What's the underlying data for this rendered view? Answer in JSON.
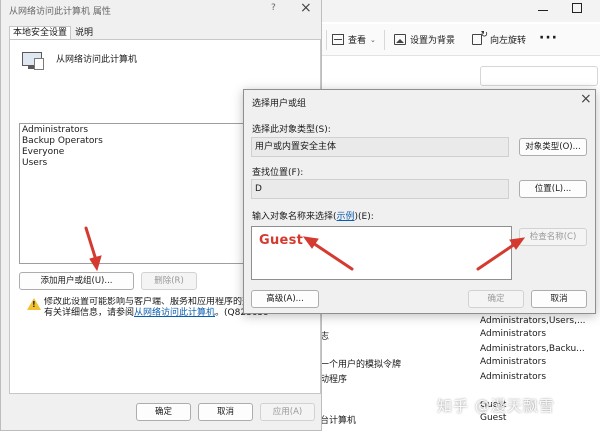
{
  "explorer": {
    "toolbar": {
      "view_label": "查看",
      "set_background_label": "设置为背景",
      "rotate_right_label": "向左旋转",
      "more_label": "···"
    },
    "policy_rows": [
      {
        "policy": "",
        "setting": "Administrators,Users,..."
      },
      {
        "policy": "志",
        "setting": "Administrators"
      },
      {
        "policy": "",
        "setting": "Administrators,Backu..."
      },
      {
        "policy": "一个用户的模拟令牌",
        "setting": "Administrators"
      },
      {
        "policy": "动程序",
        "setting": "Administrators"
      },
      {
        "policy": "",
        "setting": ""
      },
      {
        "policy": "",
        "setting": "Guest"
      },
      {
        "policy": "台计算机",
        "setting": "Guest"
      }
    ]
  },
  "properties_dialog": {
    "title": "从网络访问此计算机 属性",
    "help_label": "?",
    "tabs": [
      "本地安全设置",
      "说明"
    ],
    "policy_name": "从网络访问此计算机",
    "members": [
      "Administrators",
      "Backup Operators",
      "Everyone",
      "Users"
    ],
    "add_button": "添加用户或组(U)...",
    "remove_button": "删除(R)",
    "warning_line1": "修改此设置可能影响与客户端、服务和应用程序的兼容性",
    "warning_line2_prefix": "有关详细信息，请参阅",
    "warning_link": "从网络访问此计算机",
    "warning_line2_suffix": "。(Q823659",
    "ok_button": "确定",
    "cancel_button": "取消",
    "apply_button": "应用(A)"
  },
  "select_dialog": {
    "title": "选择用户或组",
    "object_type_label": "选择此对象类型(S):",
    "object_type_value": "用户或内置安全主体",
    "object_type_button": "对象类型(O)...",
    "location_label": "查找位置(F):",
    "location_value": "D",
    "location_button": "位置(L)...",
    "names_label_prefix": "输入对象名称来选择(",
    "names_label_link": "示例",
    "names_label_suffix": ")(E):",
    "names_value": "Guest",
    "check_names_button": "检查名称(C)",
    "advanced_button": "高级(A)...",
    "ok_button": "确定",
    "cancel_button": "取消"
  },
  "watermark": "知乎 @漫天飘雪",
  "colors": {
    "annotation_red": "#d43a2f",
    "link_blue": "#0b5cad",
    "warning_yellow": "#f2c230"
  }
}
